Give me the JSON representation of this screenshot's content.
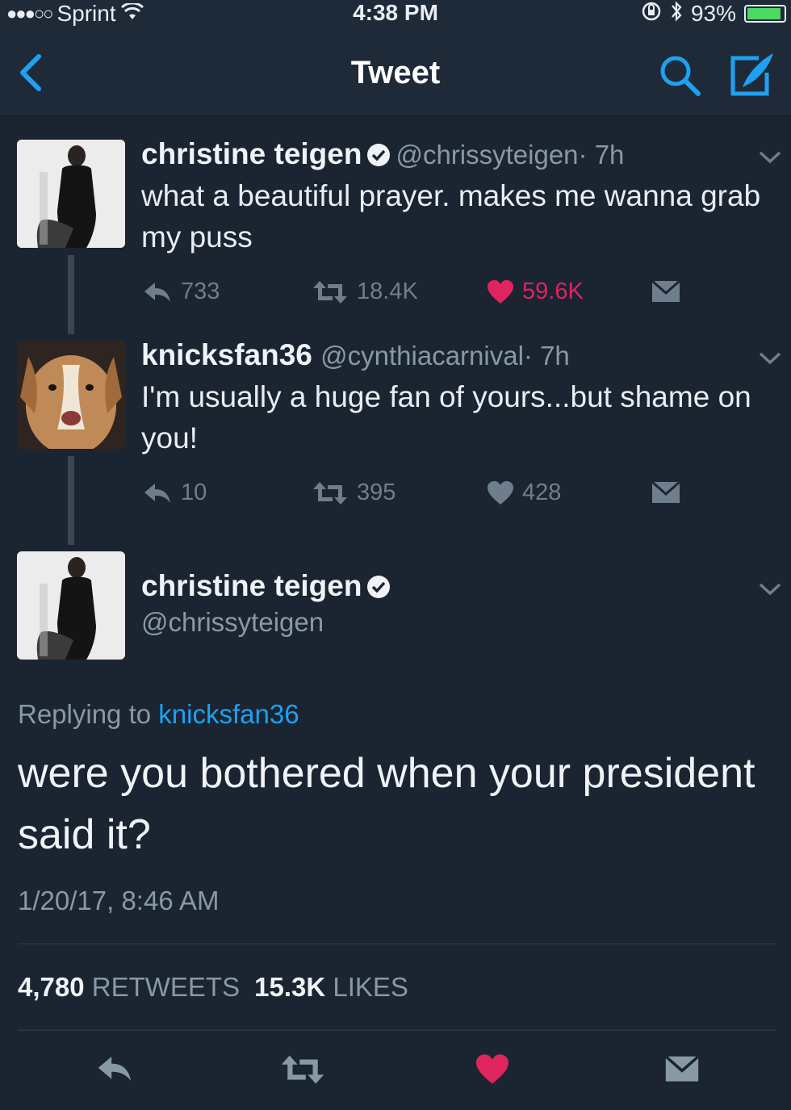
{
  "status_bar": {
    "carrier": "Sprint",
    "time": "4:38 PM",
    "battery": "93%",
    "battery_level": 0.93,
    "signal_dots": "●●●○○"
  },
  "nav": {
    "title": "Tweet",
    "icons": [
      "back-chevron-icon",
      "search-icon",
      "compose-icon"
    ]
  },
  "thread": [
    {
      "name": "christine teigen",
      "verified": true,
      "handle": "@chrissyteigen",
      "time": "· 7h",
      "text": "what a beautiful prayer. makes me wanna grab my puss",
      "replies": "733",
      "retweets": "18.4K",
      "likes": "59.6K",
      "liked": true
    },
    {
      "name": "knicksfan36",
      "verified": false,
      "handle": "@cynthiacarnival",
      "time": "· 7h",
      "text": "I'm usually a huge fan of yours...but shame on you!",
      "replies": "10",
      "retweets": "395",
      "likes": "428",
      "liked": false
    }
  ],
  "main_tweet": {
    "name": "christine teigen",
    "handle": "@chrissyteigen",
    "replying_prefix": "Replying to",
    "replying_to": "knicksfan36",
    "text": "were you bothered when your president said it?",
    "timestamp": "1/20/17, 8:46 AM",
    "retweets_count": "4,780",
    "retweets_label": "RETWEETS",
    "likes_count": "15.3K",
    "likes_label": "LIKES"
  },
  "colors": {
    "background": "#1b2431",
    "accent": "#1da1f2",
    "like": "#e0245e",
    "muted": "#8899a6"
  }
}
